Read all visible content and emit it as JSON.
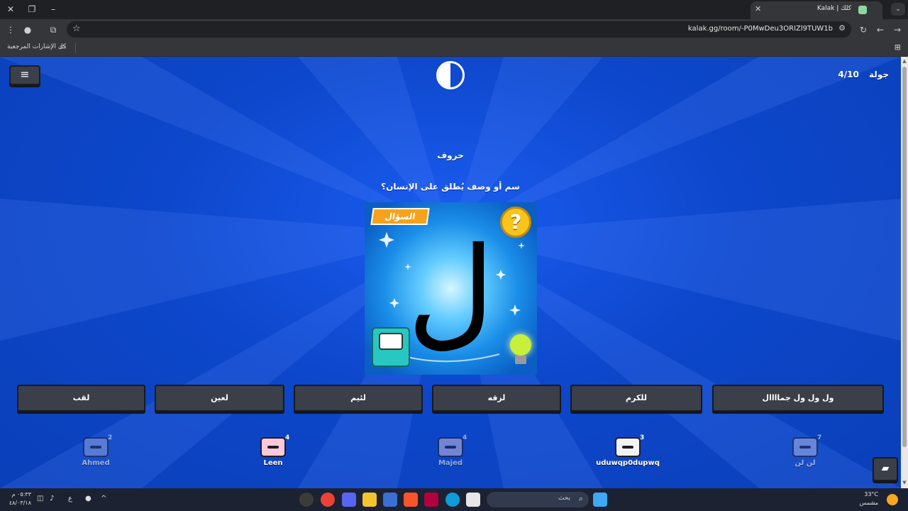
{
  "browser": {
    "tab_title": "Kalak | كلك",
    "url": "kalak.gg/room/-P0MwDeu3ORIZl9TUW1b",
    "bookmarks_label": "كل الإشارات المرجعية"
  },
  "game": {
    "round_label": "جولة",
    "round_value": "4/10",
    "category": "حروف",
    "question": "سم أو وصف يُطلق على الإنسان؟",
    "card": {
      "ribbon": "السؤال",
      "coin": "?",
      "letter": "ل"
    },
    "answers": [
      "ول ول ول جماااال",
      "للكرم",
      "لزقه",
      "لئيم",
      "لعين",
      "لقب"
    ],
    "players": [
      {
        "name": "لن لن",
        "count": "7",
        "color": "#a8b4e8",
        "dim": true
      },
      {
        "name": "uduwqp0dupwq",
        "count": "3",
        "color": "#f3f3f3",
        "dim": false
      },
      {
        "name": "Majed",
        "count": "4",
        "color": "#c8b8e0",
        "dim": true
      },
      {
        "name": "Leen",
        "count": "4",
        "color": "#ffc8d8",
        "dim": false
      },
      {
        "name": "Ahmed",
        "count": "2",
        "color": "#8aa0e0",
        "dim": true
      }
    ]
  },
  "taskbar": {
    "search_placeholder": "بحث",
    "lang": "ع",
    "clock_time": "٠٥:٣٣ م",
    "clock_date": "٤٨/٠٣/١٨",
    "weather_temp": "33°C",
    "weather_text": "مشمس"
  }
}
